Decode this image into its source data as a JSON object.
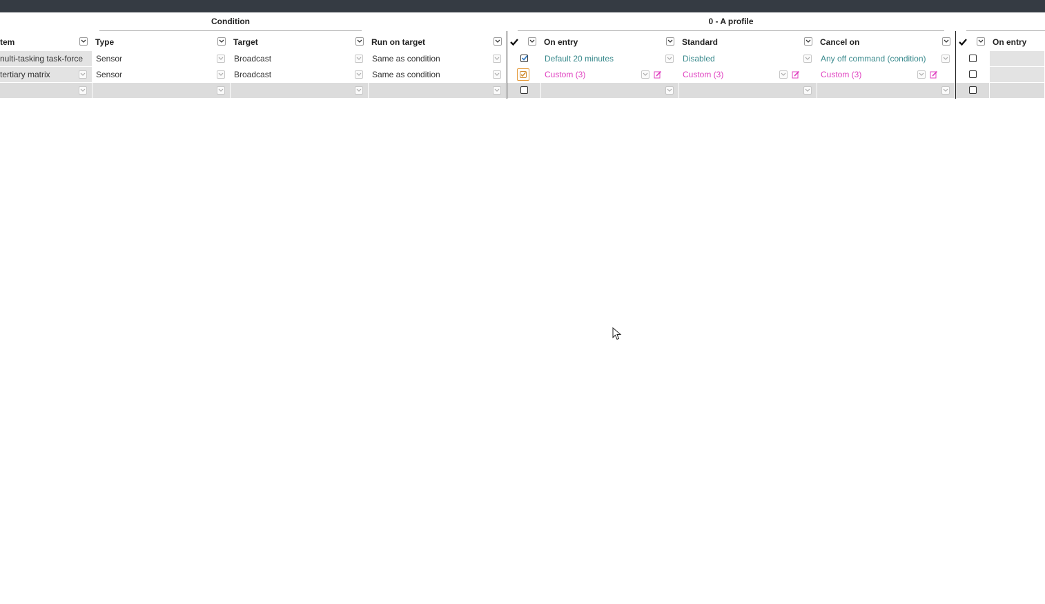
{
  "groups": {
    "condition": "Condition",
    "profile": "0 - A profile"
  },
  "headers": {
    "item": "tem",
    "type": "Type",
    "target": "Target",
    "run_on_target": "Run on target",
    "on_entry": "On entry",
    "standard": "Standard",
    "cancel_on": "Cancel on",
    "on_entry_2": "On entry"
  },
  "rows": [
    {
      "item": "nulti-tasking task-force",
      "type": "Sensor",
      "target": "Broadcast",
      "run_on_target": "Same as condition",
      "enabled": true,
      "on_entry": "Default 20 minutes",
      "standard": "Disabled",
      "cancel_on": "Any off command (condition)",
      "enabled_2": false
    },
    {
      "item": "tertiary matrix",
      "type": "Sensor",
      "target": "Broadcast",
      "run_on_target": "Same as condition",
      "enabled": true,
      "on_entry": "Custom (3)",
      "standard": "Custom (3)",
      "cancel_on": "Custom (3)",
      "enabled_2": false
    }
  ],
  "colors": {
    "topbar": "#353b43",
    "default_value": "#3a8a8d",
    "custom_value": "#e040c0",
    "empty_row": "#dcdcdc"
  },
  "icons": [
    "chevron-down-icon",
    "checkmark-icon",
    "edit-icon",
    "cursor-icon"
  ]
}
